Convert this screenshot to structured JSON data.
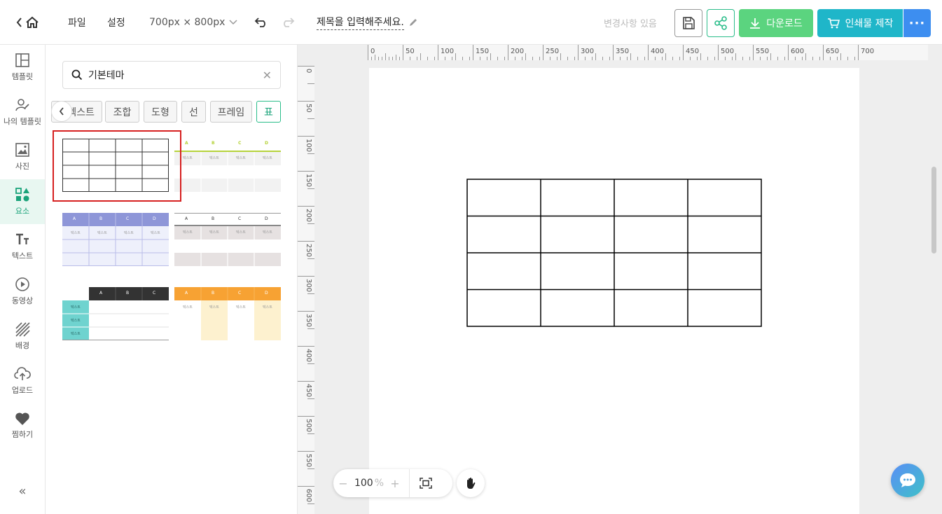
{
  "topbar": {
    "menu_file": "파일",
    "menu_settings": "설정",
    "size_label": "700px × 800px",
    "doc_title": "제목을 입력해주세요.",
    "save_status": "변경사항 있음",
    "download_label": "다운로드",
    "print_label": "인쇄물 제작",
    "more_label": "···"
  },
  "nav": {
    "items": [
      {
        "label": "템플릿",
        "icon": "template-icon"
      },
      {
        "label": "나의 템플릿",
        "icon": "my-template-icon"
      },
      {
        "label": "사진",
        "icon": "photo-icon"
      },
      {
        "label": "요소",
        "icon": "element-icon",
        "active": true
      },
      {
        "label": "텍스트",
        "icon": "text-icon"
      },
      {
        "label": "동영상",
        "icon": "video-icon"
      },
      {
        "label": "배경",
        "icon": "background-icon"
      },
      {
        "label": "업로드",
        "icon": "upload-icon"
      },
      {
        "label": "찜하기",
        "icon": "heart-icon"
      }
    ],
    "collapse_label": "«"
  },
  "panel": {
    "search_value": "기본테마",
    "categories": [
      {
        "label": "텍스트",
        "active": false
      },
      {
        "label": "조합",
        "active": false
      },
      {
        "label": "도형",
        "active": false
      },
      {
        "label": "선",
        "active": false
      },
      {
        "label": "프레임",
        "active": false
      },
      {
        "label": "표",
        "active": true
      }
    ],
    "thumb_labels": {
      "headers": [
        "A",
        "B",
        "C",
        "D"
      ],
      "cell": "텍스트"
    },
    "colors": {
      "green_line": "#b6d33c",
      "purple_header": "#8e96d8",
      "gray_header": "#d8d3d3",
      "dark_header": "#333333",
      "teal_col": "#6fd3cf",
      "orange_header": "#f7a233",
      "cream_col": "#fdf1cf"
    }
  },
  "rulers": {
    "h_labels": [
      "0",
      "50",
      "100",
      "150",
      "200",
      "250",
      "300",
      "350",
      "400",
      "450",
      "500",
      "550",
      "600",
      "650",
      "700"
    ],
    "v_labels": [
      "0",
      "50",
      "100",
      "150",
      "200",
      "250",
      "300",
      "350",
      "400",
      "450",
      "500",
      "550",
      "600"
    ]
  },
  "canvas": {
    "table_rows": 4,
    "table_cols": 4
  },
  "zoom": {
    "minus": "−",
    "value": "100",
    "unit": "%",
    "plus": "+"
  },
  "colors": {
    "accent_green": "#5bd47f",
    "accent_teal": "#1fb6c9",
    "accent_blue": "#3d8ef0",
    "active_nav": "#1aa37a"
  }
}
